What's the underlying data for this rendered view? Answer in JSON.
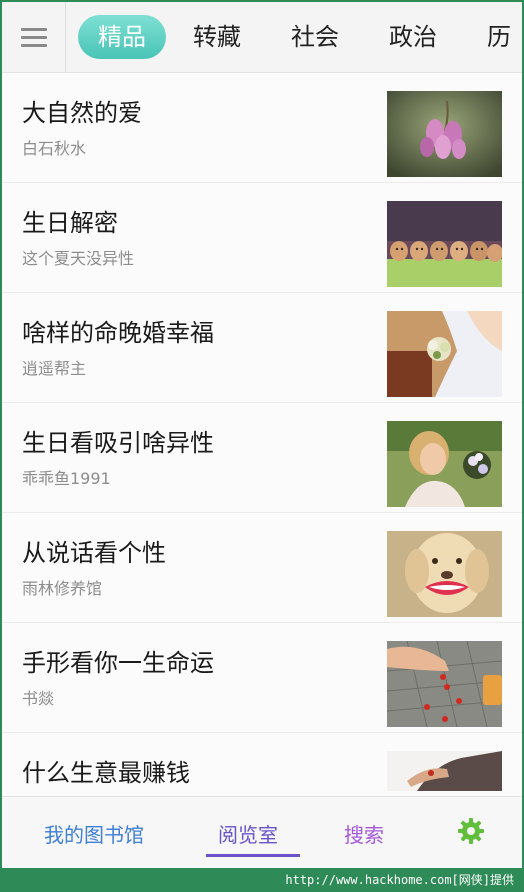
{
  "topbar": {
    "menu_icon": "hamburger-menu-icon",
    "tabs": [
      {
        "label": "精品",
        "active": true
      },
      {
        "label": "转藏",
        "active": false
      },
      {
        "label": "社会",
        "active": false
      },
      {
        "label": "政治",
        "active": false
      },
      {
        "label": "历",
        "active": false
      }
    ]
  },
  "articles": [
    {
      "title": "大自然的爱",
      "author": "白石秋水",
      "thumb": "pink-flower-photo"
    },
    {
      "title": "生日解密",
      "author": "这个夏天没异性",
      "thumb": "eggs-with-faces-photo"
    },
    {
      "title": "啥样的命晚婚幸福",
      "author": "逍遥帮主",
      "thumb": "bride-bouquet-photo"
    },
    {
      "title": "生日看吸引啥异性",
      "author": "乖乖鱼1991",
      "thumb": "woman-with-flowers-photo"
    },
    {
      "title": "从说话看个性",
      "author": "雨林修养馆",
      "thumb": "dog-with-lips-photo"
    },
    {
      "title": "手形看你一生命运",
      "author": "书燚",
      "thumb": "hand-with-berries-photo"
    },
    {
      "title": "什么生意最赚钱",
      "author": "",
      "thumb": "hand-photo"
    }
  ],
  "bottom_nav": {
    "library": "我的图书馆",
    "reading_room": "阅览室",
    "search": "搜索",
    "settings_icon": "gear-icon",
    "active": "阅览室"
  },
  "colors": {
    "accent_tab": "#48c4b6",
    "library": "#3f7fd4",
    "reading_room": "#6a52c8",
    "search": "#a45ad8",
    "settings": "#5fbf3a",
    "footer": "#2e8b57"
  },
  "footer": {
    "text": "http://www.hackhome.com[网侠]提供"
  }
}
